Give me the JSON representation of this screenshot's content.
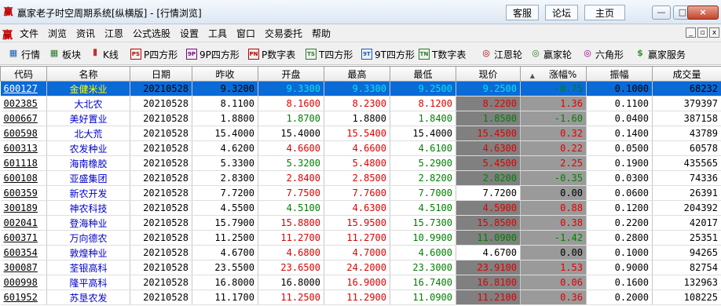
{
  "window": {
    "title": "赢家老子时空周期系统[纵横版] - [行情浏览]",
    "links": [
      "客服",
      "论坛",
      "主页"
    ],
    "controls": [
      "—",
      "□",
      "×"
    ]
  },
  "menu": [
    "文件",
    "浏览",
    "资讯",
    "江恩",
    "公式选股",
    "设置",
    "工具",
    "窗口",
    "交易委托",
    "帮助"
  ],
  "mdi_controls": [
    "_",
    "▫",
    "x"
  ],
  "toolbar": [
    {
      "label": "行情",
      "glyph": "▦",
      "color": "#1a5fb4"
    },
    {
      "label": "板块",
      "glyph": "▦",
      "color": "#2a7a2a"
    },
    {
      "label": "K线",
      "glyph": "⫴",
      "color": "#c00000"
    },
    {
      "label": "P四方形",
      "glyph": "PS",
      "color": "#c00000"
    },
    {
      "label": "9P四方形",
      "glyph": "9P",
      "color": "#8b008b"
    },
    {
      "label": "P数字表",
      "glyph": "PN",
      "color": "#c00000"
    },
    {
      "label": "T四方形",
      "glyph": "TS",
      "color": "#2a7a2a"
    },
    {
      "label": "9T四方形",
      "glyph": "9T",
      "color": "#1a5fb4"
    },
    {
      "label": "T数字表",
      "glyph": "TN",
      "color": "#2a7a2a"
    },
    {
      "label": "江恩轮",
      "glyph": "◎",
      "color": "#8b0000"
    },
    {
      "label": "赢家轮",
      "glyph": "◎",
      "color": "#2a7a2a"
    },
    {
      "label": "六角形",
      "glyph": "◎",
      "color": "#8b008b"
    },
    {
      "label": "赢家服务",
      "glyph": "$",
      "color": "#2a9a2a"
    }
  ],
  "table": {
    "headers": [
      "代码",
      "名称",
      "日期",
      "昨收",
      "开盘",
      "最高",
      "最低",
      "现价",
      "涨幅%",
      "振幅",
      "成交量"
    ],
    "selected_row": 0,
    "rows": [
      [
        "600127",
        "金健米业",
        "20210528",
        "9.3200",
        "9.3300",
        "9.3300",
        "9.2500",
        "9.2500",
        "-0.75",
        "0.1000",
        "68232"
      ],
      [
        "002385",
        "大北农",
        "20210528",
        "8.1100",
        "8.1600",
        "8.2300",
        "8.1200",
        "8.2200",
        "1.36",
        "0.1100",
        "379397"
      ],
      [
        "000667",
        "美好置业",
        "20210528",
        "1.8800",
        "1.8700",
        "1.8800",
        "1.8400",
        "1.8500",
        "-1.60",
        "0.0400",
        "387158"
      ],
      [
        "600598",
        "北大荒",
        "20210528",
        "15.4000",
        "15.4000",
        "15.5400",
        "15.4000",
        "15.4500",
        "0.32",
        "0.1400",
        "43789"
      ],
      [
        "600313",
        "农发种业",
        "20210528",
        "4.6200",
        "4.6600",
        "4.6600",
        "4.6100",
        "4.6300",
        "0.22",
        "0.0500",
        "60578"
      ],
      [
        "601118",
        "海南橡胶",
        "20210528",
        "5.3300",
        "5.3200",
        "5.4800",
        "5.2900",
        "5.4500",
        "2.25",
        "0.1900",
        "435565"
      ],
      [
        "600108",
        "亚盛集团",
        "20210528",
        "2.8300",
        "2.8400",
        "2.8500",
        "2.8200",
        "2.8200",
        "-0.35",
        "0.0300",
        "74336"
      ],
      [
        "600359",
        "新农开发",
        "20210528",
        "7.7200",
        "7.7500",
        "7.7600",
        "7.7000",
        "7.7200",
        "0.00",
        "0.0600",
        "26391"
      ],
      [
        "300189",
        "神农科技",
        "20210528",
        "4.5500",
        "4.5100",
        "4.6300",
        "4.5100",
        "4.5900",
        "0.88",
        "0.1200",
        "204392"
      ],
      [
        "002041",
        "登海种业",
        "20210528",
        "15.7900",
        "15.8800",
        "15.9500",
        "15.7300",
        "15.8500",
        "0.38",
        "0.2200",
        "42017"
      ],
      [
        "600371",
        "万向德农",
        "20210528",
        "11.2500",
        "11.2700",
        "11.2700",
        "10.9900",
        "11.0900",
        "-1.42",
        "0.2800",
        "25351"
      ],
      [
        "600354",
        "敦煌种业",
        "20210528",
        "4.6700",
        "4.6800",
        "4.7000",
        "4.6000",
        "4.6700",
        "0.00",
        "0.1000",
        "94265"
      ],
      [
        "300087",
        "荃银高科",
        "20210528",
        "23.5500",
        "23.6500",
        "24.2000",
        "23.3000",
        "23.9100",
        "1.53",
        "0.9000",
        "82754"
      ],
      [
        "000998",
        "隆平高科",
        "20210528",
        "16.8000",
        "16.8000",
        "16.9000",
        "16.7400",
        "16.8100",
        "0.06",
        "0.1600",
        "132963"
      ],
      [
        "601952",
        "苏垦农发",
        "20210528",
        "11.1700",
        "11.2500",
        "11.2900",
        "11.0900",
        "11.2100",
        "0.36",
        "0.2000",
        "108225"
      ]
    ]
  }
}
